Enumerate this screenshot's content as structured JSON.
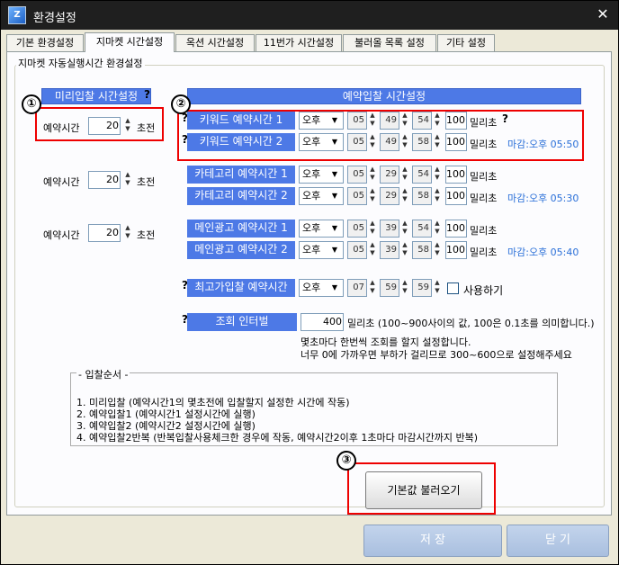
{
  "window": {
    "title": "환경설정",
    "close_label": "✕"
  },
  "tabs": [
    {
      "label": "기본 환경설정",
      "active": false
    },
    {
      "label": "지마켓 시간설정",
      "active": true
    },
    {
      "label": "옥션 시간설정",
      "active": false
    },
    {
      "label": "11번가 시간설정",
      "active": false
    },
    {
      "label": "불러올 목록 설정",
      "active": false
    },
    {
      "label": "기타 설정",
      "active": false
    }
  ],
  "group": {
    "title": "지마켓 자동실행시간 환경설정"
  },
  "headers": {
    "pre_bid": "미리입찰 시간설정",
    "schedule": "예약입찰 시간설정",
    "help": "?"
  },
  "pre_bid_rows": [
    {
      "label": "예약시간",
      "value": "20",
      "unit": "초전"
    },
    {
      "label": "예약시간",
      "value": "20",
      "unit": "초전"
    },
    {
      "label": "예약시간",
      "value": "20",
      "unit": "초전"
    }
  ],
  "schedule_rows": [
    {
      "label": "키워드 예약시간 1",
      "ampm": "오후",
      "h": "05",
      "m": "49",
      "s": "54",
      "ms": "100",
      "ms_unit": "밀리초",
      "deadline": ""
    },
    {
      "label": "키워드 예약시간 2",
      "ampm": "오후",
      "h": "05",
      "m": "49",
      "s": "58",
      "ms": "100",
      "ms_unit": "밀리초",
      "deadline": "마감:오후 05:50"
    },
    {
      "label": "카테고리 예약시간 1",
      "ampm": "오후",
      "h": "05",
      "m": "29",
      "s": "54",
      "ms": "100",
      "ms_unit": "밀리초",
      "deadline": ""
    },
    {
      "label": "카테고리 예약시간 2",
      "ampm": "오후",
      "h": "05",
      "m": "29",
      "s": "58",
      "ms": "100",
      "ms_unit": "밀리초",
      "deadline": "마감:오후 05:30"
    },
    {
      "label": "메인광고 예약시간 1",
      "ampm": "오후",
      "h": "05",
      "m": "39",
      "s": "54",
      "ms": "100",
      "ms_unit": "밀리초",
      "deadline": ""
    },
    {
      "label": "메인광고 예약시간 2",
      "ampm": "오후",
      "h": "05",
      "m": "39",
      "s": "58",
      "ms": "100",
      "ms_unit": "밀리초",
      "deadline": "마감:오후 05:40"
    }
  ],
  "max_bid": {
    "label": "최고가입찰 예약시간",
    "ampm": "오후",
    "h": "07",
    "m": "59",
    "s": "59",
    "use_label": "사용하기",
    "checked": false
  },
  "interval": {
    "label": "조회 인터벌",
    "value": "400",
    "desc": "밀리초 (100~900사이의 값, 100은 0.1초를 의미합니다.)",
    "line2": "몇초마다 한번씩 조회를 할지 설정합니다.",
    "line3": "너무 0에 가까우면 부하가 걸리므로 300~600으로 설정해주세요"
  },
  "order": {
    "title": "- 입찰순서 -",
    "lines": [
      "1. 미리입찰 (예약시간1의 몇초전에 입찰할지 설정한 시간에 작동)",
      "2. 예약입찰1 (예약시간1 설정시간에 실행)",
      "3. 예약입찰2 (예약시간2 설정시간에 실행)",
      "4. 예약입찰2반복 (반복입찰사용체크한 경우에 작동, 예약시간2이후 1초마다 마감시간까지 반복)"
    ]
  },
  "buttons": {
    "load_default": "기본값 불러오기",
    "save": "저  장",
    "close": "닫  기"
  },
  "markers": [
    "①",
    "②",
    "③"
  ],
  "colors": {
    "header_blue": "#4d79e6",
    "highlight_red": "#e00000",
    "deadline_blue": "#2a6fd8"
  }
}
